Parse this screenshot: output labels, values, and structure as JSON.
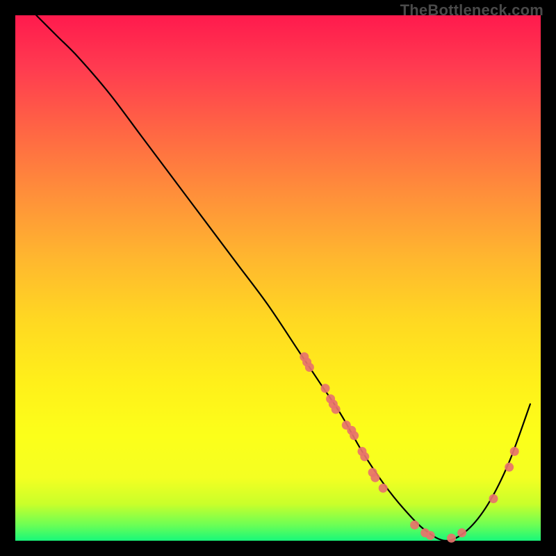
{
  "watermark": "TheBottleneck.com",
  "chart_data": {
    "type": "line",
    "title": "",
    "xlabel": "",
    "ylabel": "",
    "xlim": [
      0,
      100
    ],
    "ylim": [
      0,
      100
    ],
    "grid": false,
    "background": "rainbow-gradient",
    "series": [
      {
        "name": "bottleneck-curve",
        "x": [
          4,
          8,
          12,
          18,
          24,
          30,
          36,
          42,
          48,
          54,
          58,
          62,
          66,
          70,
          74,
          78,
          82,
          86,
          90,
          94,
          98
        ],
        "y": [
          100,
          96,
          92,
          85,
          77,
          69,
          61,
          53,
          45,
          36,
          30,
          24,
          17,
          11,
          6,
          2,
          0,
          2,
          7,
          15,
          26
        ],
        "color": "#000000"
      }
    ],
    "scatter_points": {
      "name": "marked-gpus",
      "color": "#e7736b",
      "points": [
        {
          "x": 55,
          "y": 35
        },
        {
          "x": 55.5,
          "y": 34
        },
        {
          "x": 56,
          "y": 33
        },
        {
          "x": 59,
          "y": 29
        },
        {
          "x": 60,
          "y": 27
        },
        {
          "x": 60.5,
          "y": 26
        },
        {
          "x": 61,
          "y": 25
        },
        {
          "x": 63,
          "y": 22
        },
        {
          "x": 64,
          "y": 21
        },
        {
          "x": 64.5,
          "y": 20
        },
        {
          "x": 66,
          "y": 17
        },
        {
          "x": 66.5,
          "y": 16
        },
        {
          "x": 68,
          "y": 13
        },
        {
          "x": 68.5,
          "y": 12
        },
        {
          "x": 70,
          "y": 10
        },
        {
          "x": 76,
          "y": 3
        },
        {
          "x": 78,
          "y": 1.5
        },
        {
          "x": 79,
          "y": 1
        },
        {
          "x": 83,
          "y": 0.5
        },
        {
          "x": 85,
          "y": 1.5
        },
        {
          "x": 91,
          "y": 8
        },
        {
          "x": 94,
          "y": 14
        },
        {
          "x": 95,
          "y": 17
        }
      ]
    }
  }
}
